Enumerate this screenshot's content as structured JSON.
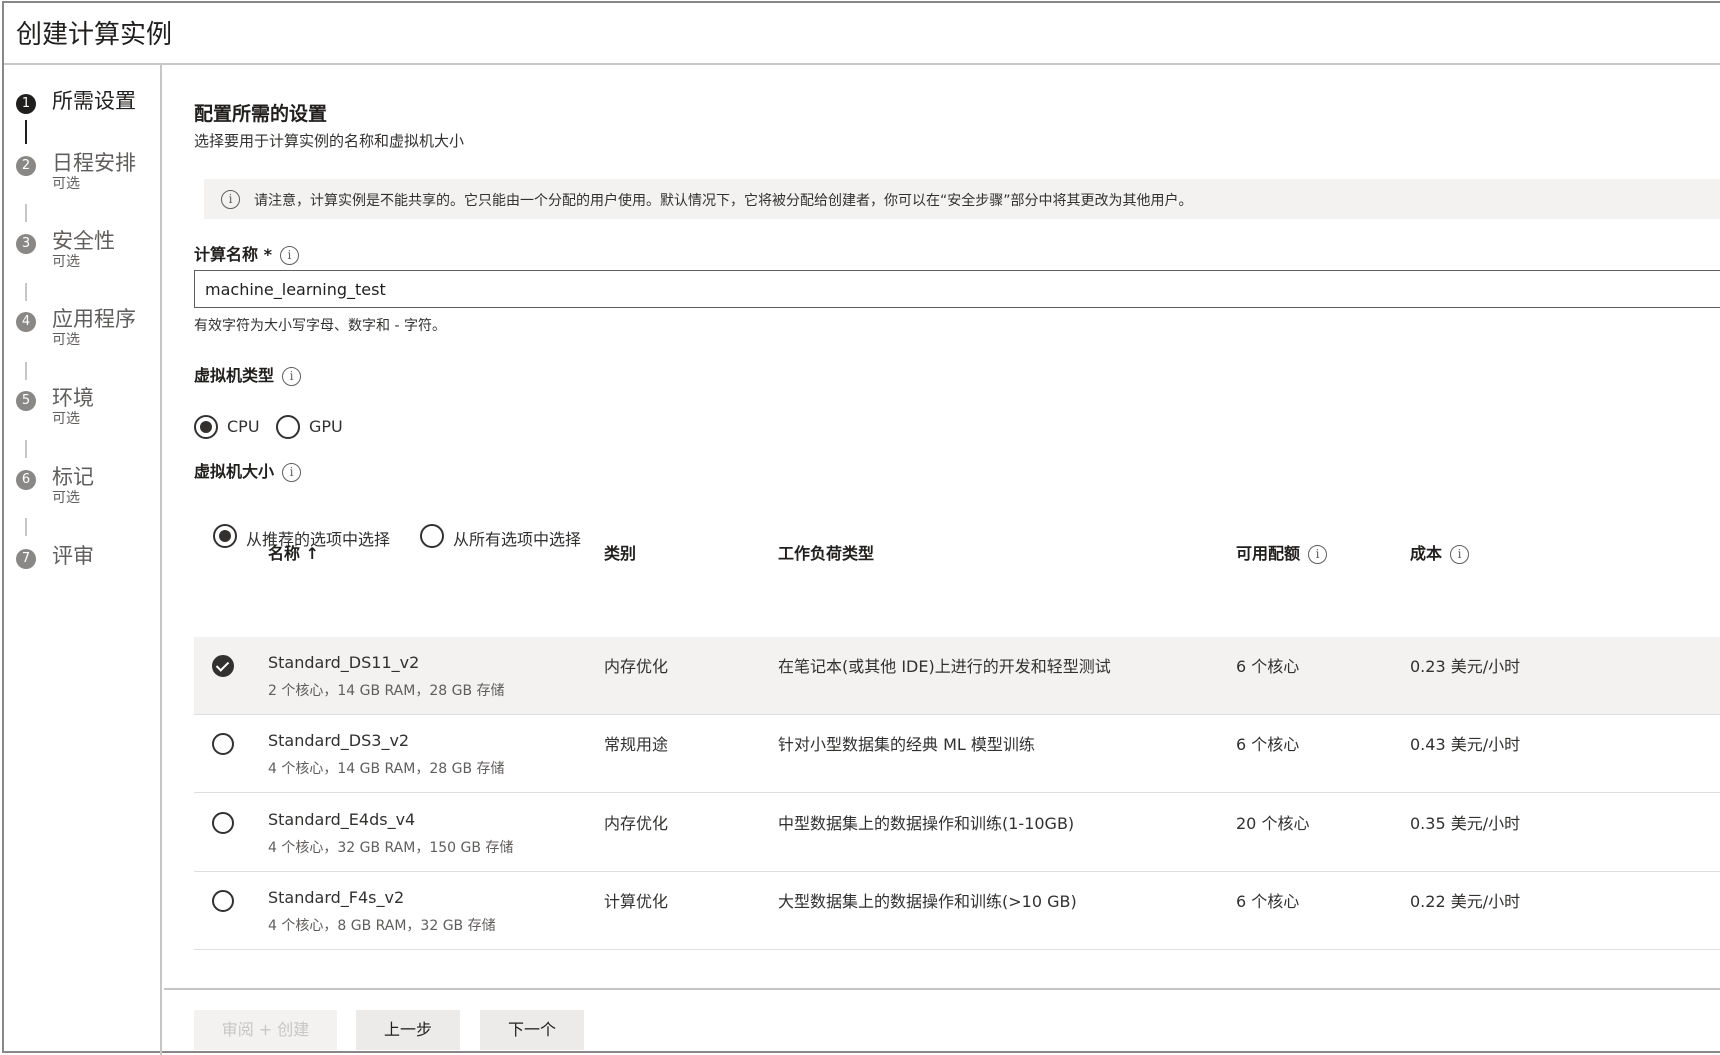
{
  "window": {
    "title": "创建计算实例"
  },
  "steps": [
    {
      "num": "1",
      "label": "所需设置",
      "sub": ""
    },
    {
      "num": "2",
      "label": "日程安排",
      "sub": "可选"
    },
    {
      "num": "3",
      "label": "安全性",
      "sub": "可选"
    },
    {
      "num": "4",
      "label": "应用程序",
      "sub": "可选"
    },
    {
      "num": "5",
      "label": "环境",
      "sub": "可选"
    },
    {
      "num": "6",
      "label": "标记",
      "sub": "可选"
    },
    {
      "num": "7",
      "label": "评审",
      "sub": ""
    }
  ],
  "section": {
    "title": "配置所需的设置",
    "subtitle": "选择要用于计算实例的名称和虚拟机大小"
  },
  "notice": {
    "icon": "info-icon",
    "text": "请注意，计算实例是不能共享的。它只能由一个分配的用户使用。默认情况下，它将被分配给创建者，你可以在“安全步骤”部分中将其更改为其他用户。"
  },
  "compute_name": {
    "label": "计算名称 *",
    "value": "machine_learning_test",
    "hint": "有效字符为大小写字母、数字和 - 字符。"
  },
  "vm_type": {
    "label": "虚拟机类型",
    "options": [
      "CPU",
      "GPU"
    ],
    "selected": "CPU"
  },
  "vm_size": {
    "label": "虚拟机大小",
    "options": [
      "从推荐的选项中选择",
      "从所有选项中选择"
    ],
    "selected": "从推荐的选项中选择"
  },
  "table": {
    "headers": {
      "name": "名称 ↑",
      "category": "类别",
      "workload": "工作负荷类型",
      "quota": "可用配额",
      "cost": "成本"
    },
    "rows": [
      {
        "name": "Standard_DS11_v2",
        "spec": "2 个核心，14 GB RAM，28 GB 存储",
        "category": "内存优化",
        "workload": "在笔记本(或其他 IDE)上进行的开发和轻型测试",
        "quota": "6 个核心",
        "cost": "0.23 美元/小时",
        "selected": true
      },
      {
        "name": "Standard_DS3_v2",
        "spec": "4 个核心，14 GB RAM，28 GB 存储",
        "category": "常规用途",
        "workload": "针对小型数据集的经典 ML 模型训练",
        "quota": "6 个核心",
        "cost": "0.43 美元/小时",
        "selected": false
      },
      {
        "name": "Standard_E4ds_v4",
        "spec": "4 个核心，32 GB RAM，150 GB 存储",
        "category": "内存优化",
        "workload": "中型数据集上的数据操作和训练(1-10GB)",
        "quota": "20 个核心",
        "cost": "0.35 美元/小时",
        "selected": false
      },
      {
        "name": "Standard_F4s_v2",
        "spec": "4 个核心，8 GB RAM，32 GB 存储",
        "category": "计算优化",
        "workload": "大型数据集上的数据操作和训练(>10 GB)",
        "quota": "6 个核心",
        "cost": "0.22 美元/小时",
        "selected": false
      }
    ]
  },
  "footer": {
    "review_create": "审阅 + 创建",
    "previous": "上一步",
    "next": "下一个"
  }
}
